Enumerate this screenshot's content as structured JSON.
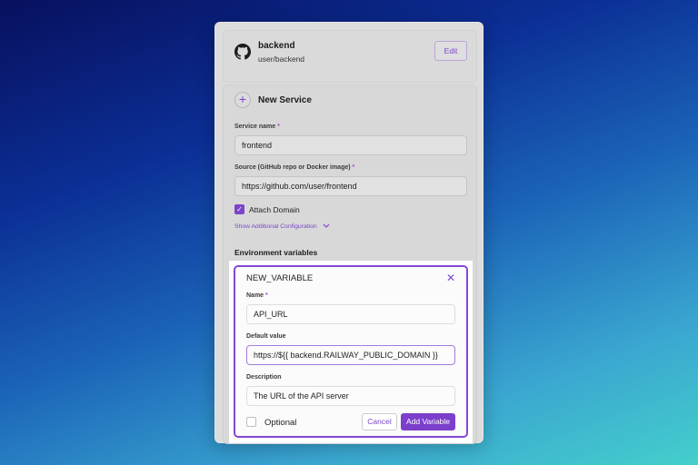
{
  "repo": {
    "name": "backend",
    "path": "user/backend",
    "edit_label": "Edit"
  },
  "service": {
    "title": "New Service",
    "name_label": "Service name",
    "name_value": "frontend",
    "source_label": "Source (GitHub repo or Docker image)",
    "source_value": "https://github.com/user/frontend",
    "required_mark": "*",
    "attach_domain_label": "Attach Domain",
    "attach_domain_checked": true,
    "show_additional_label": "Show Additional Configuration",
    "env_title": "Environment variables"
  },
  "variable": {
    "title": "NEW_VARIABLE",
    "name_label": "Name",
    "name_value": "API_URL",
    "default_label": "Default value",
    "default_value": "https://${{ backend.RAILWAY_PUBLIC_DOMAIN }}",
    "description_label": "Description",
    "description_value": "The URL of the API server",
    "optional_label": "Optional",
    "cancel_label": "Cancel",
    "add_label": "Add Variable"
  },
  "colors": {
    "accent": "#7b45c9",
    "button_primary": "#7b3fcc"
  },
  "icons": {
    "repo": "github-icon",
    "new_service": "plus-icon",
    "close": "close-icon",
    "expand": "chevron-down-icon",
    "check": "check-icon"
  }
}
